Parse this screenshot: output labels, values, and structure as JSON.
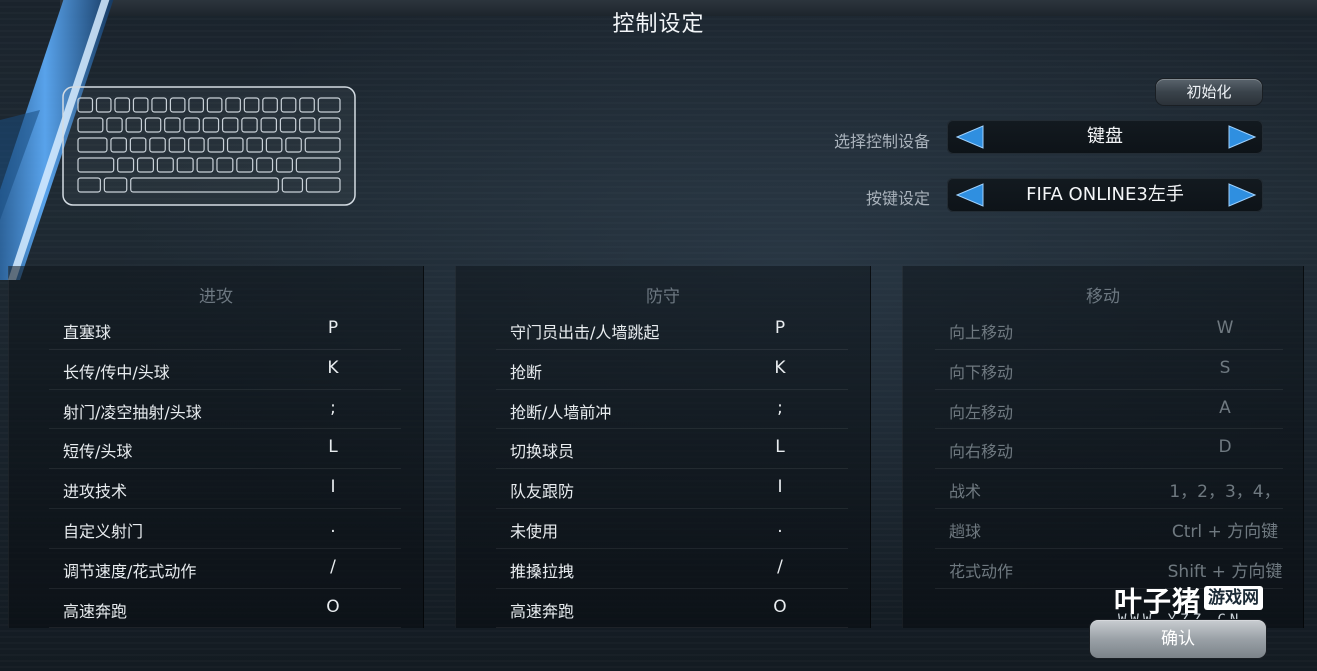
{
  "title": "控制设定",
  "init_button": "初始化",
  "confirm_button": "确认",
  "device": {
    "label": "选择控制设备",
    "value": "键盘"
  },
  "keyset": {
    "label": "按键设定",
    "value": "FIFA ONLINE3左手"
  },
  "panels": {
    "attack": {
      "header": "进攻",
      "rows": [
        {
          "label": "直塞球",
          "key": "P"
        },
        {
          "label": "长传/传中/头球",
          "key": "K"
        },
        {
          "label": "射门/凌空抽射/头球",
          "key": ";"
        },
        {
          "label": "短传/头球",
          "key": "L"
        },
        {
          "label": "进攻技术",
          "key": "I"
        },
        {
          "label": "自定义射门",
          "key": "."
        },
        {
          "label": "调节速度/花式动作",
          "key": "/"
        },
        {
          "label": "高速奔跑",
          "key": "O"
        }
      ]
    },
    "defense": {
      "header": "防守",
      "rows": [
        {
          "label": "守门员出击/人墙跳起",
          "key": "P"
        },
        {
          "label": "抢断",
          "key": "K"
        },
        {
          "label": "抢断/人墙前冲",
          "key": ";"
        },
        {
          "label": "切换球员",
          "key": "L"
        },
        {
          "label": "队友跟防",
          "key": "I"
        },
        {
          "label": "未使用",
          "key": "."
        },
        {
          "label": "推搡拉拽",
          "key": "/"
        },
        {
          "label": "高速奔跑",
          "key": "O"
        }
      ]
    },
    "move": {
      "header": "移动",
      "rows": [
        {
          "label": "向上移动",
          "key": "W"
        },
        {
          "label": "向下移动",
          "key": "S"
        },
        {
          "label": "向左移动",
          "key": "A"
        },
        {
          "label": "向右移动",
          "key": "D"
        },
        {
          "label": "战术",
          "key": "1，2，3，4，"
        },
        {
          "label": "趟球",
          "key": "Ctrl + 方向键"
        },
        {
          "label": "花式动作",
          "key": "Shift + 方向键"
        }
      ]
    }
  },
  "watermark": {
    "brand": "叶子猪",
    "badge": "游戏网",
    "url": "WWW.YZZ.CN"
  },
  "colors": {
    "accent_blue": "#2f8fe0",
    "panel_header": "#6c7780"
  },
  "icons": {
    "keyboard": "keyboard-icon",
    "prev": "arrow-left-icon",
    "next": "arrow-right-icon"
  }
}
